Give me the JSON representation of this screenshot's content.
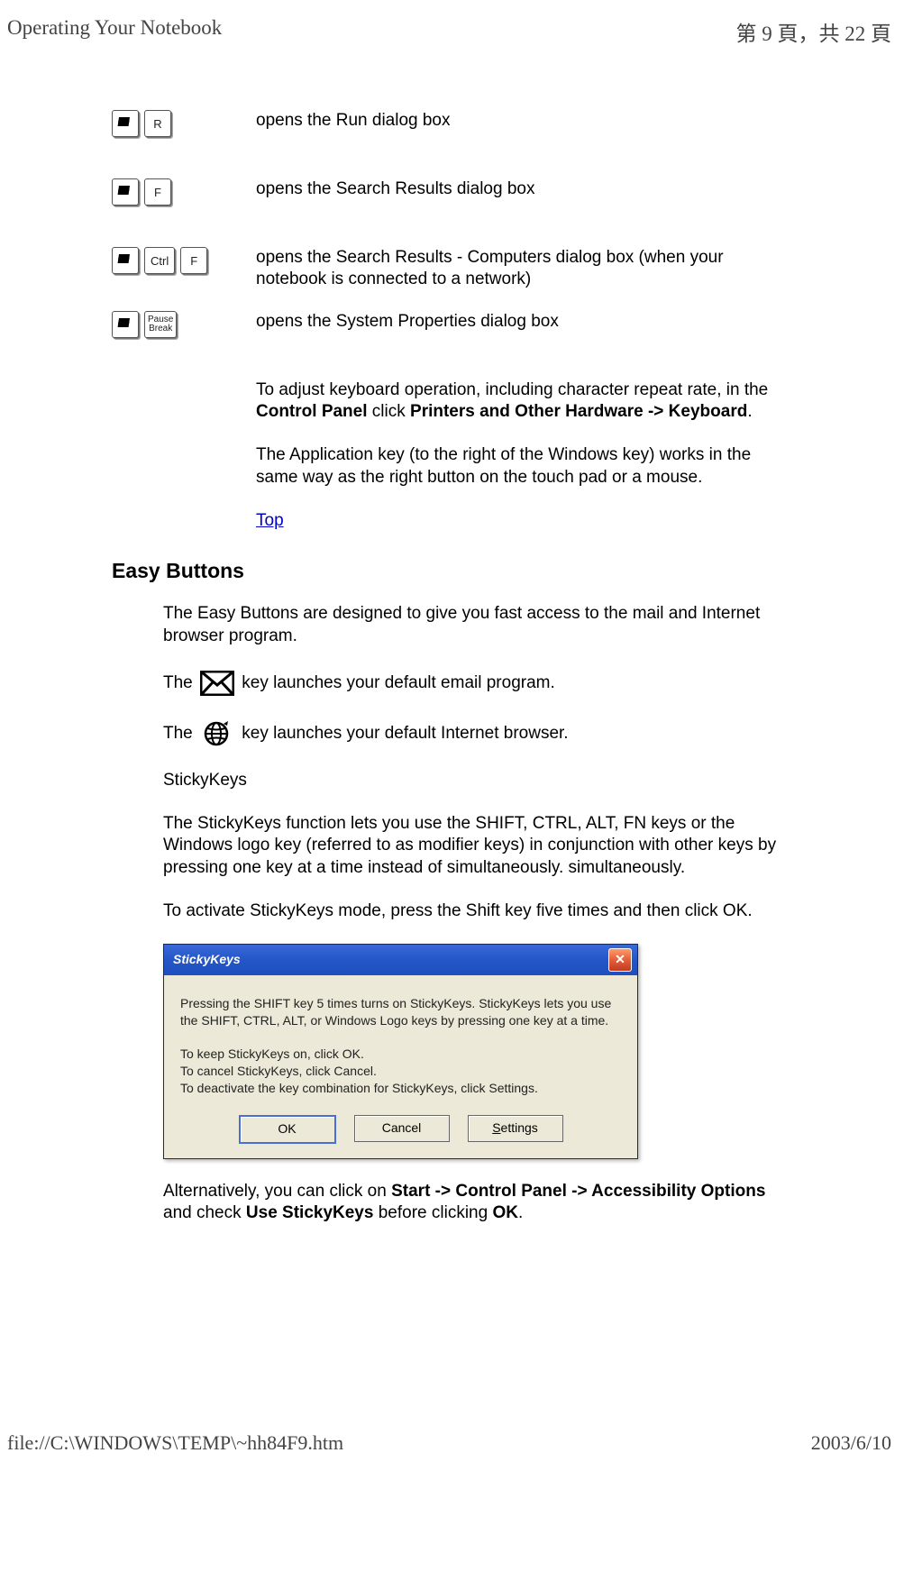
{
  "header": {
    "title_left": "Operating Your Notebook",
    "title_right": "第 9 頁，共 22 頁"
  },
  "shortcuts": {
    "r": {
      "key_label": "R",
      "desc": "opens the Run dialog box"
    },
    "f": {
      "key_label": "F",
      "desc": "opens the Search Results dialog box"
    },
    "ctrl_f": {
      "key_ctrl": "Ctrl",
      "key_f": "F",
      "desc": "opens the Search Results - Computers dialog box (when your notebook is connected to a network)"
    },
    "pause": {
      "key_label_line1": "Pause",
      "key_label_line2": "Break",
      "desc": "opens the System Properties dialog box"
    }
  },
  "info": {
    "adjust_pre": "To adjust keyboard operation, including character repeat rate, in the ",
    "adjust_bold1": "Control Panel",
    "adjust_mid": " click ",
    "adjust_bold2": "Printers and Other Hardware -> Keyboard",
    "adjust_post": ".",
    "appkey": "The Application key (to the right of the Windows key) works in the same way as the right button on the touch pad or a mouse.",
    "top_link": "Top"
  },
  "easy": {
    "heading": "Easy Buttons",
    "intro": "The Easy Buttons are designed to give you fast access to the mail and Internet browser program.",
    "mail_pre": "The ",
    "mail_post": " key launches your default email program.",
    "globe_pre": "The ",
    "globe_post": " key launches your default Internet browser.",
    "sticky_sub": "StickyKeys",
    "sticky_p1": "The StickyKeys function lets you use the SHIFT, CTRL, ALT, FN keys or the Windows logo key (referred to as modifier keys) in conjunction with other keys by pressing one key at a time instead of simultaneously. simultaneously.",
    "sticky_p2": "To activate StickyKeys mode, press the Shift key five times and then click OK."
  },
  "dialog": {
    "title": "StickyKeys",
    "close": "✕",
    "body1": "Pressing the SHIFT key 5 times turns on StickyKeys. StickyKeys lets you use the SHIFT, CTRL, ALT, or Windows Logo keys by pressing one key at a time.",
    "body2a": "To keep StickyKeys on, click OK.",
    "body2b": "To cancel StickyKeys, click Cancel.",
    "body2c": "To deactivate the key combination for StickyKeys, click Settings.",
    "btn_ok": "OK",
    "btn_cancel": "Cancel",
    "btn_settings_u": "S",
    "btn_settings_rest": "ettings"
  },
  "alt": {
    "pre": "Alternatively, you can click on ",
    "bold1": "Start -> Control Panel -> Accessibility Options",
    "mid1": " and check ",
    "bold2": "Use StickyKeys",
    "mid2": " before clicking ",
    "bold3": "OK",
    "post": "."
  },
  "footer": {
    "left": "file://C:\\WINDOWS\\TEMP\\~hh84F9.htm",
    "right": "2003/6/10"
  }
}
